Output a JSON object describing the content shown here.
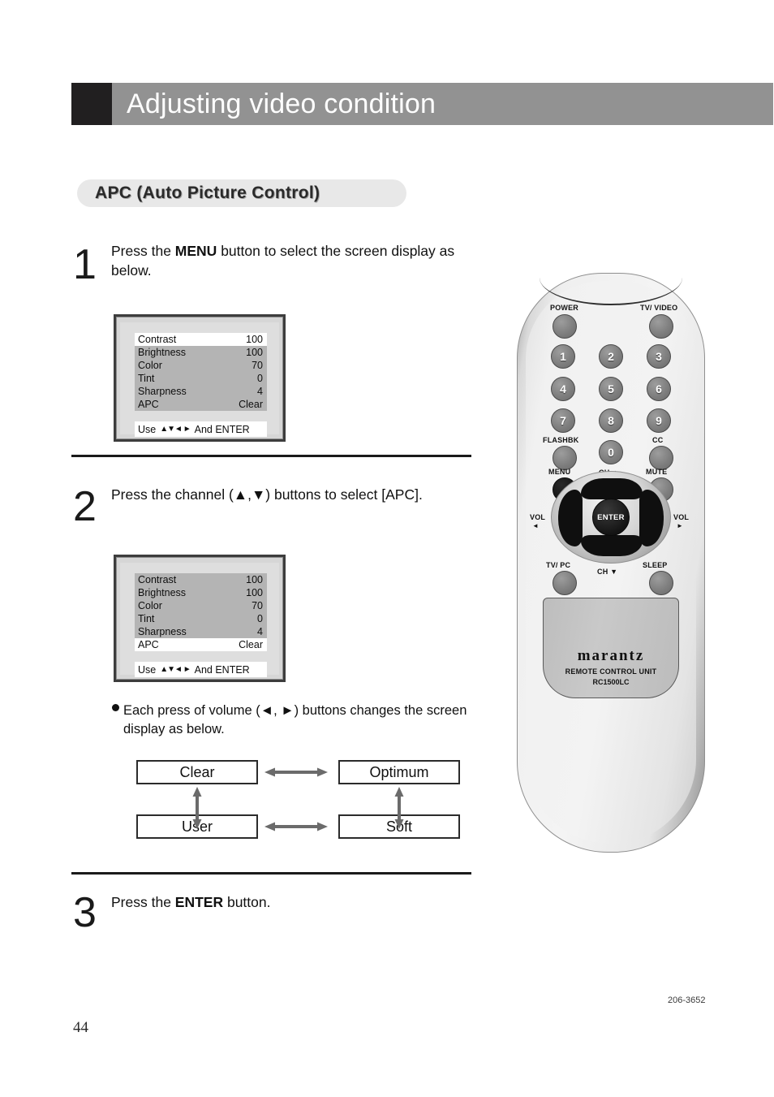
{
  "header": {
    "title": "Adjusting video condition"
  },
  "section": {
    "title": "APC (Auto Picture Control)"
  },
  "steps": [
    {
      "number": "1",
      "text_parts": [
        "Press the ",
        "MENU",
        " button to select the screen display as below."
      ],
      "plain": "Press the MENU button to select the screen display as below."
    },
    {
      "number": "2",
      "plain": "Press the channel (▲,▼) buttons to select [APC]."
    },
    {
      "number": "3",
      "text_parts": [
        "Press the ",
        "ENTER",
        " button."
      ],
      "plain": "Press the ENTER button."
    }
  ],
  "osd1": {
    "rows": [
      {
        "label": "Contrast",
        "value": "100",
        "highlight": true
      },
      {
        "label": "Brightness",
        "value": "100",
        "highlight": false
      },
      {
        "label": "Color",
        "value": "70",
        "highlight": false
      },
      {
        "label": "Tint",
        "value": "0",
        "highlight": false
      },
      {
        "label": "Sharpness",
        "value": "4",
        "highlight": false
      },
      {
        "label": "APC",
        "value": "Clear",
        "highlight": false
      }
    ],
    "footer_use": "Use",
    "footer_arrows": "▲▼◄ ►",
    "footer_enter": "And ENTER"
  },
  "osd2": {
    "rows": [
      {
        "label": "Contrast",
        "value": "100",
        "highlight": false
      },
      {
        "label": "Brightness",
        "value": "100",
        "highlight": false
      },
      {
        "label": "Color",
        "value": "70",
        "highlight": false
      },
      {
        "label": "Tint",
        "value": "0",
        "highlight": false
      },
      {
        "label": "Sharpness",
        "value": "4",
        "highlight": false
      },
      {
        "label": "APC",
        "value": "Clear",
        "highlight": true
      }
    ],
    "footer_use": "Use",
    "footer_arrows": "▲▼◄ ►",
    "footer_enter": "And ENTER"
  },
  "note": {
    "text": "Each press of volume (◄, ►) buttons changes the screen display as below."
  },
  "modes": {
    "clear": "Clear",
    "optimum": "Optimum",
    "user": "User",
    "soft": "Soft"
  },
  "footer": {
    "page_number": "44",
    "doc_code": "206-3652"
  },
  "remote": {
    "labels": {
      "power": "POWER",
      "tv_video": "TV/ VIDEO",
      "flashbk": "FLASHBK",
      "cc": "CC",
      "menu": "MENU",
      "mute": "MUTE",
      "ch_up": "CH ▲",
      "ch_down": "CH ▼",
      "vol_left_top": "VOL",
      "vol_left_bottom": "◄",
      "vol_right_top": "VOL",
      "vol_right_bottom": "►",
      "tv_pc": "TV/ PC",
      "sleep": "SLEEP",
      "enter": "ENTER"
    },
    "numbers": [
      "1",
      "2",
      "3",
      "4",
      "5",
      "6",
      "7",
      "8",
      "9",
      "0"
    ],
    "brand": {
      "name": "marantz",
      "subtitle": "REMOTE CONTROL UNIT",
      "model": "RC1500LC"
    }
  },
  "colors": {
    "header_band": "#929292",
    "header_swatch": "#211f20",
    "pill_bg": "#e8e8e8",
    "osd_menu_bg": "#b4b4b4",
    "osd_highlight": "#ffffff",
    "arrow_gray": "#6b6b6b"
  }
}
